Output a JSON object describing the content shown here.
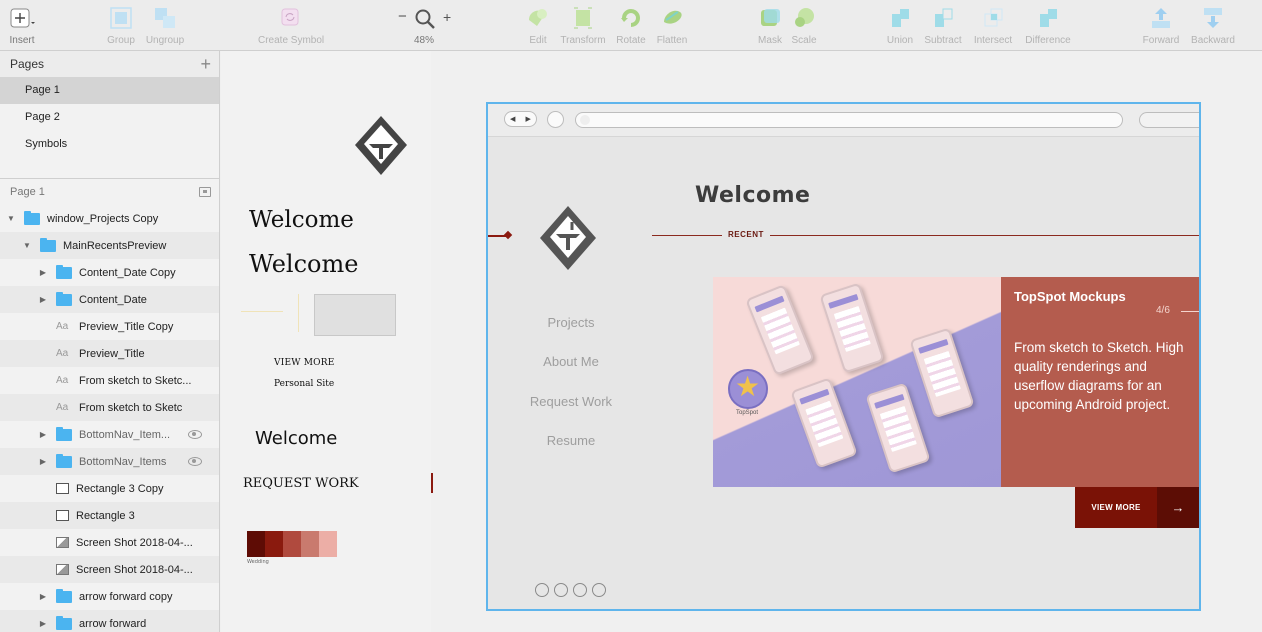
{
  "toolbar": {
    "insert": "Insert",
    "group": "Group",
    "ungroup": "Ungroup",
    "create_symbol": "Create Symbol",
    "zoom_minus": "−",
    "zoom_plus": "+",
    "zoom_level": "48%",
    "edit": "Edit",
    "transform": "Transform",
    "rotate": "Rotate",
    "flatten": "Flatten",
    "mask": "Mask",
    "scale": "Scale",
    "union": "Union",
    "subtract": "Subtract",
    "intersect": "Intersect",
    "difference": "Difference",
    "forward": "Forward",
    "backward": "Backward"
  },
  "sidebar": {
    "pages_title": "Pages",
    "pages": [
      "Page 1",
      "Page 2",
      "Symbols"
    ],
    "layers_title": "Page 1",
    "layers": [
      {
        "label": "window_Projects Copy",
        "type": "folder",
        "indent": 0,
        "arrow": "▼"
      },
      {
        "label": "MainRecentsPreview",
        "type": "folder",
        "indent": 1,
        "arrow": "▼"
      },
      {
        "label": "Content_Date Copy",
        "type": "folder",
        "indent": 2,
        "arrow": "▶"
      },
      {
        "label": "Content_Date",
        "type": "folder",
        "indent": 2,
        "arrow": "▶"
      },
      {
        "label": "Preview_Title Copy",
        "type": "text",
        "indent": 2,
        "arrow": ""
      },
      {
        "label": "Preview_Title",
        "type": "text",
        "indent": 2,
        "arrow": ""
      },
      {
        "label": "From sketch to Sketc...",
        "type": "text",
        "indent": 2,
        "arrow": ""
      },
      {
        "label": "From sketch to Sketc",
        "type": "text",
        "indent": 2,
        "arrow": ""
      },
      {
        "label": "BottomNav_Item...",
        "type": "folder",
        "indent": 2,
        "arrow": "▶",
        "hidden": true
      },
      {
        "label": "BottomNav_Items",
        "type": "folder",
        "indent": 2,
        "arrow": "▶",
        "hidden": true
      },
      {
        "label": "Rectangle 3 Copy",
        "type": "rect",
        "indent": 2,
        "arrow": ""
      },
      {
        "label": "Rectangle 3",
        "type": "rect",
        "indent": 2,
        "arrow": ""
      },
      {
        "label": "Screen Shot 2018-04-...",
        "type": "image",
        "indent": 2,
        "arrow": ""
      },
      {
        "label": "Screen Shot 2018-04-...",
        "type": "image",
        "indent": 2,
        "arrow": ""
      },
      {
        "label": "arrow forward copy",
        "type": "folder",
        "indent": 2,
        "arrow": "▶"
      },
      {
        "label": "arrow forward",
        "type": "folder",
        "indent": 2,
        "arrow": "▶"
      }
    ]
  },
  "left_artboard": {
    "welcome_1": "Welcome",
    "welcome_2": "Welcome",
    "view_more": "VIEW MORE",
    "personal_site": "Personal Site",
    "welcome_3": "Welcome",
    "request_work": "REQUEST WORK",
    "swatch_label": "Wedding",
    "swatches": [
      "#5e0c05",
      "#8a1a0e",
      "#b04a3e",
      "#c97a6e",
      "#ecaea6"
    ]
  },
  "site": {
    "nav_back": "◀",
    "nav_forward": "▶",
    "title": "Welcome",
    "recent_label": "RECENT",
    "nav_links": [
      "Projects",
      "About Me",
      "Request Work",
      "Resume"
    ],
    "badge_label": "TopSpot",
    "card_title": "TopSpot Mockups",
    "card_count": "4/6",
    "card_body": "From sketch to Sketch. High quality renderings and userflow diagrams for an upcoming Android project.",
    "view_more": "VIEW MORE",
    "view_more_arrow": "→",
    "accent": "#b45c4e",
    "dark_accent": "#7a1206",
    "selection_color": "#5fb5ec"
  }
}
